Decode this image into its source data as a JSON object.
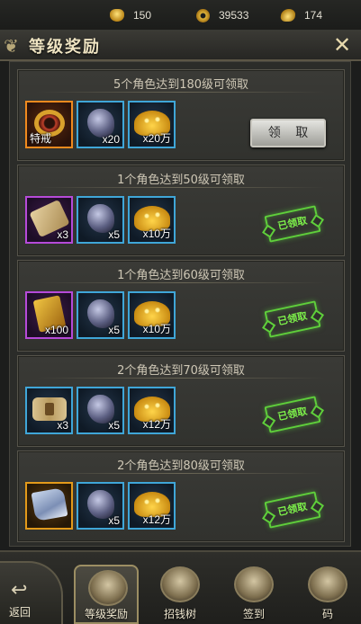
{
  "topbar": {
    "currencies": [
      {
        "icon": "gold-ingot-icon",
        "value": "150"
      },
      {
        "icon": "copper-coin-icon",
        "value": "39533"
      },
      {
        "icon": "silver-ingot-icon",
        "value": "174"
      }
    ]
  },
  "header": {
    "title": "等级奖励",
    "close_icon": "close-icon"
  },
  "rewards": [
    {
      "caption": "5个角色达到180级可领取",
      "status": "claimable",
      "button_label": "领 取",
      "items": [
        {
          "name": "special-ring",
          "rarity": "orange",
          "qty": "特戒",
          "qty_left": true
        },
        {
          "name": "ore",
          "rarity": "blue",
          "qty": "x20"
        },
        {
          "name": "gold-pile",
          "rarity": "blue",
          "qty": "x20万"
        }
      ]
    },
    {
      "caption": "1个角色达到50级可领取",
      "status": "claimed",
      "stamp_label": "已领取",
      "items": [
        {
          "name": "scroll",
          "rarity": "purple",
          "qty": "x3"
        },
        {
          "name": "ore",
          "rarity": "blue",
          "qty": "x5"
        },
        {
          "name": "gold-pile",
          "rarity": "blue",
          "qty": "x10万"
        }
      ]
    },
    {
      "caption": "1个角色达到60级可领取",
      "status": "claimed",
      "stamp_label": "已领取",
      "items": [
        {
          "name": "book",
          "rarity": "purple",
          "qty": "x100"
        },
        {
          "name": "ore",
          "rarity": "blue",
          "qty": "x5"
        },
        {
          "name": "gold-pile",
          "rarity": "blue",
          "qty": "x10万"
        }
      ]
    },
    {
      "caption": "2个角色达到70级可领取",
      "status": "claimed",
      "stamp_label": "已领取",
      "items": [
        {
          "name": "map",
          "rarity": "blue",
          "qty": "x3"
        },
        {
          "name": "ore",
          "rarity": "blue",
          "qty": "x5"
        },
        {
          "name": "gold-pile",
          "rarity": "blue",
          "qty": "x12万"
        }
      ]
    },
    {
      "caption": "2个角色达到80级可领取",
      "status": "claimed",
      "stamp_label": "已领取",
      "items": [
        {
          "name": "cloth",
          "rarity": "gold",
          "qty": ""
        },
        {
          "name": "ore",
          "rarity": "blue",
          "qty": "x5"
        },
        {
          "name": "gold-pile",
          "rarity": "blue",
          "qty": "x12万"
        }
      ]
    }
  ],
  "bottom_nav": {
    "back_label": "返回",
    "tabs": [
      {
        "label": "等级奖励",
        "active": true
      },
      {
        "label": "招钱树",
        "active": false
      },
      {
        "label": "签到",
        "active": false
      },
      {
        "label": "码",
        "active": false
      }
    ]
  }
}
